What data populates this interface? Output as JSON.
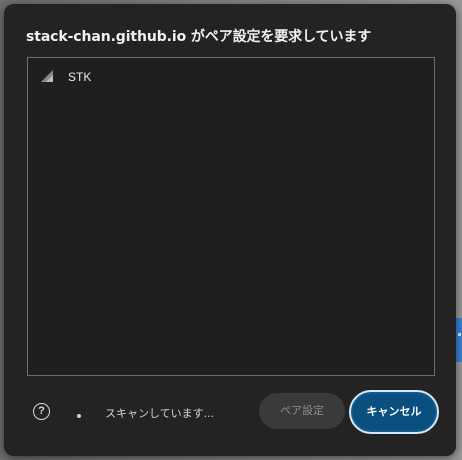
{
  "dialog": {
    "title": "stack-chan.github.io がペア設定を要求しています"
  },
  "devices": [
    {
      "name": "STK",
      "icon": "signal-strength-icon"
    }
  ],
  "footer": {
    "help_icon": "help-circle-icon",
    "help_glyph": "?",
    "spinner_icon": "spinner-icon",
    "status_text": "スキャンしています...",
    "pair_label": "ペア設定",
    "cancel_label": "キャンセル"
  },
  "colors": {
    "dialog_bg": "#232323",
    "cancel_button": "#0b4f7f",
    "disabled_button": "#3a3a3a",
    "page_accent": "#3a82d6"
  }
}
